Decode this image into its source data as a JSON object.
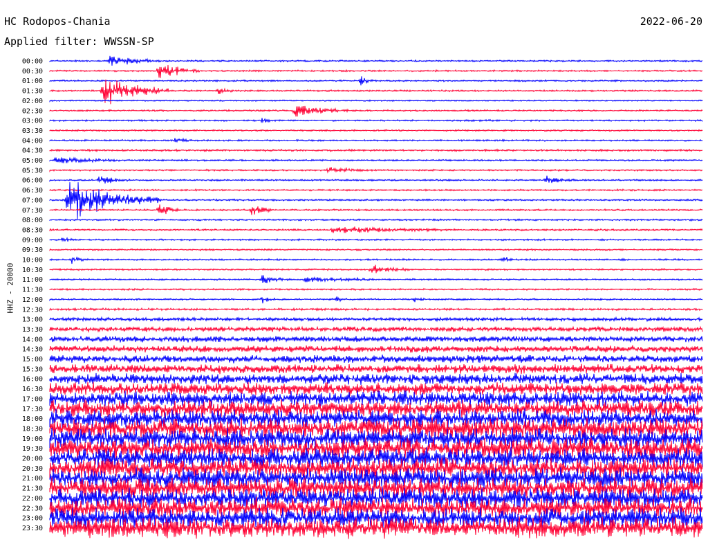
{
  "header": {
    "station": "HC Rodopos-Chania",
    "filter": "Applied filter: WWSSN-SP",
    "date": "2022-06-20",
    "channel_label": "HHZ - 20000"
  },
  "colors": {
    "trace_a": "#0000ff",
    "trace_b": "#ff0033",
    "text": "#000000",
    "background": "#ffffff"
  },
  "chart_data": {
    "type": "line",
    "title": "HC Rodopos-Chania",
    "subtitle": "Applied filter: WWSSN-SP",
    "date": "2022-06-20",
    "ylabel": "HHZ - 20000",
    "rows": [
      {
        "label": "00:00",
        "color": "blue",
        "noise": 1.0,
        "events": [
          {
            "minute": 5.5,
            "amp": 7,
            "dur": 2
          }
        ]
      },
      {
        "label": "00:30",
        "color": "red",
        "noise": 1.0,
        "events": [
          {
            "minute": 10,
            "amp": 12,
            "dur": 1.5
          }
        ]
      },
      {
        "label": "01:00",
        "color": "blue",
        "noise": 1.0,
        "events": [
          {
            "minute": 28.5,
            "amp": 6,
            "dur": 0.6
          }
        ]
      },
      {
        "label": "01:30",
        "color": "red",
        "noise": 1.0,
        "events": [
          {
            "minute": 4.8,
            "amp": 22,
            "dur": 2.5
          },
          {
            "minute": 15.5,
            "amp": 4,
            "dur": 0.6
          }
        ]
      },
      {
        "label": "02:00",
        "color": "blue",
        "noise": 0.8,
        "events": []
      },
      {
        "label": "02:30",
        "color": "red",
        "noise": 1.0,
        "events": [
          {
            "minute": 22.5,
            "amp": 9,
            "dur": 2.0
          }
        ]
      },
      {
        "label": "03:00",
        "color": "blue",
        "noise": 1.0,
        "events": [
          {
            "minute": 19.5,
            "amp": 4,
            "dur": 0.4
          }
        ]
      },
      {
        "label": "03:30",
        "color": "red",
        "noise": 1.0,
        "events": []
      },
      {
        "label": "04:00",
        "color": "blue",
        "noise": 1.0,
        "events": [
          {
            "minute": 11.5,
            "amp": 4,
            "dur": 0.5
          }
        ]
      },
      {
        "label": "04:30",
        "color": "red",
        "noise": 1.2,
        "events": []
      },
      {
        "label": "05:00",
        "color": "blue",
        "noise": 1.0,
        "events": [
          {
            "minute": 0.5,
            "amp": 5,
            "dur": 2.5
          }
        ]
      },
      {
        "label": "05:30",
        "color": "red",
        "noise": 1.0,
        "events": [
          {
            "minute": 25.5,
            "amp": 4,
            "dur": 1.5
          }
        ]
      },
      {
        "label": "06:00",
        "color": "blue",
        "noise": 1.0,
        "events": [
          {
            "minute": 4.5,
            "amp": 6,
            "dur": 1.2
          },
          {
            "minute": 45.5,
            "amp": 6,
            "dur": 1.2
          }
        ]
      },
      {
        "label": "06:30",
        "color": "red",
        "noise": 1.0,
        "events": []
      },
      {
        "label": "07:00",
        "color": "blue",
        "noise": 1.0,
        "events": [
          {
            "minute": 1.5,
            "amp": 28,
            "dur": 3.5
          }
        ]
      },
      {
        "label": "07:30",
        "color": "red",
        "noise": 1.0,
        "events": [
          {
            "minute": 10,
            "amp": 8,
            "dur": 1.0
          },
          {
            "minute": 18.5,
            "amp": 10,
            "dur": 0.8
          }
        ]
      },
      {
        "label": "08:00",
        "color": "blue",
        "noise": 1.0,
        "events": []
      },
      {
        "label": "08:30",
        "color": "red",
        "noise": 1.1,
        "events": [
          {
            "minute": 26,
            "amp": 5,
            "dur": 4.0
          }
        ]
      },
      {
        "label": "09:00",
        "color": "blue",
        "noise": 1.0,
        "events": [
          {
            "minute": 1.2,
            "amp": 5,
            "dur": 0.4
          }
        ]
      },
      {
        "label": "09:30",
        "color": "red",
        "noise": 1.0,
        "events": []
      },
      {
        "label": "10:00",
        "color": "blue",
        "noise": 1.0,
        "events": [
          {
            "minute": 2,
            "amp": 5,
            "dur": 0.6
          },
          {
            "minute": 41.5,
            "amp": 6,
            "dur": 0.5
          }
        ]
      },
      {
        "label": "10:30",
        "color": "red",
        "noise": 1.0,
        "events": [
          {
            "minute": 29.5,
            "amp": 5,
            "dur": 1.5
          }
        ]
      },
      {
        "label": "11:00",
        "color": "blue",
        "noise": 1.0,
        "events": [
          {
            "minute": 19.5,
            "amp": 6,
            "dur": 1.0
          },
          {
            "minute": 23.5,
            "amp": 5,
            "dur": 2.5
          }
        ]
      },
      {
        "label": "11:30",
        "color": "red",
        "noise": 1.0,
        "events": []
      },
      {
        "label": "12:00",
        "color": "blue",
        "noise": 1.0,
        "events": [
          {
            "minute": 19.5,
            "amp": 5,
            "dur": 0.5
          },
          {
            "minute": 26,
            "amp": 4,
            "dur": 0.6
          },
          {
            "minute": 33.5,
            "amp": 5,
            "dur": 0.4
          }
        ]
      },
      {
        "label": "12:30",
        "color": "red",
        "noise": 1.3,
        "events": []
      },
      {
        "label": "13:00",
        "color": "blue",
        "noise": 2.0,
        "events": []
      },
      {
        "label": "13:30",
        "color": "red",
        "noise": 3.0,
        "events": []
      },
      {
        "label": "14:00",
        "color": "blue",
        "noise": 3.5,
        "events": []
      },
      {
        "label": "14:30",
        "color": "red",
        "noise": 4.0,
        "events": []
      },
      {
        "label": "15:00",
        "color": "blue",
        "noise": 4.5,
        "events": []
      },
      {
        "label": "15:30",
        "color": "red",
        "noise": 5.5,
        "events": []
      },
      {
        "label": "16:00",
        "color": "blue",
        "noise": 6.5,
        "events": []
      },
      {
        "label": "16:30",
        "color": "red",
        "noise": 7.5,
        "events": []
      },
      {
        "label": "17:00",
        "color": "blue",
        "noise": 9.0,
        "events": []
      },
      {
        "label": "17:30",
        "color": "red",
        "noise": 10.0,
        "events": []
      },
      {
        "label": "18:00",
        "color": "blue",
        "noise": 11.0,
        "events": []
      },
      {
        "label": "18:30",
        "color": "red",
        "noise": 12.0,
        "events": []
      },
      {
        "label": "19:00",
        "color": "blue",
        "noise": 12.0,
        "events": []
      },
      {
        "label": "19:30",
        "color": "red",
        "noise": 12.0,
        "events": []
      },
      {
        "label": "20:00",
        "color": "blue",
        "noise": 12.0,
        "events": []
      },
      {
        "label": "20:30",
        "color": "red",
        "noise": 12.0,
        "events": []
      },
      {
        "label": "21:00",
        "color": "blue",
        "noise": 12.0,
        "events": []
      },
      {
        "label": "21:30",
        "color": "red",
        "noise": 12.0,
        "events": []
      },
      {
        "label": "22:00",
        "color": "blue",
        "noise": 12.0,
        "events": []
      },
      {
        "label": "22:30",
        "color": "red",
        "noise": 12.0,
        "events": []
      },
      {
        "label": "23:00",
        "color": "blue",
        "noise": 12.0,
        "events": []
      },
      {
        "label": "23:30",
        "color": "red",
        "noise": 12.0,
        "events": []
      }
    ],
    "minutes_per_row": 60,
    "grid": false,
    "legend": "none"
  }
}
